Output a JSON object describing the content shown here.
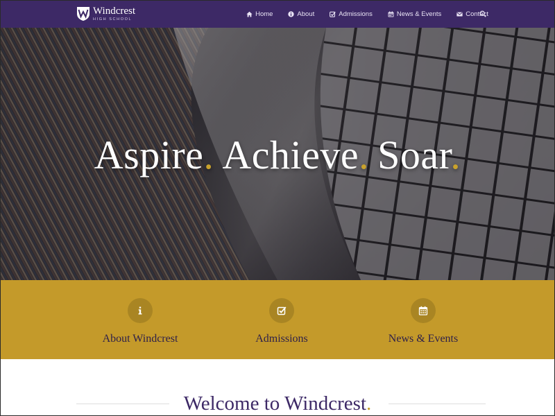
{
  "brand": {
    "name": "Windcrest",
    "subtitle": "HIGH SCHOOL",
    "logo_icon": "w-shield-logo"
  },
  "nav": {
    "items": [
      {
        "label": "Home",
        "icon": "home-icon"
      },
      {
        "label": "About",
        "icon": "info-circle-icon"
      },
      {
        "label": "Admissions",
        "icon": "check-square-icon"
      },
      {
        "label": "News & Events",
        "icon": "calendar-icon"
      },
      {
        "label": "Contact",
        "icon": "envelope-icon"
      }
    ],
    "search_icon": "search-icon"
  },
  "hero": {
    "words": [
      "Aspire",
      "Achieve",
      "Soar"
    ],
    "punctuation": "."
  },
  "features": [
    {
      "label": "About Windcrest",
      "icon": "info-icon"
    },
    {
      "label": "Admissions",
      "icon": "check-square-icon"
    },
    {
      "label": "News & Events",
      "icon": "calendar-icon"
    }
  ],
  "welcome": {
    "heading": "Welcome to Windcrest",
    "punctuation": "."
  },
  "colors": {
    "nav_bg": "#3d2966",
    "gold": "#c49a2a",
    "gold_dark": "#a98523",
    "purple_text": "#3d2966",
    "accent_dot": "#c9a22c"
  }
}
